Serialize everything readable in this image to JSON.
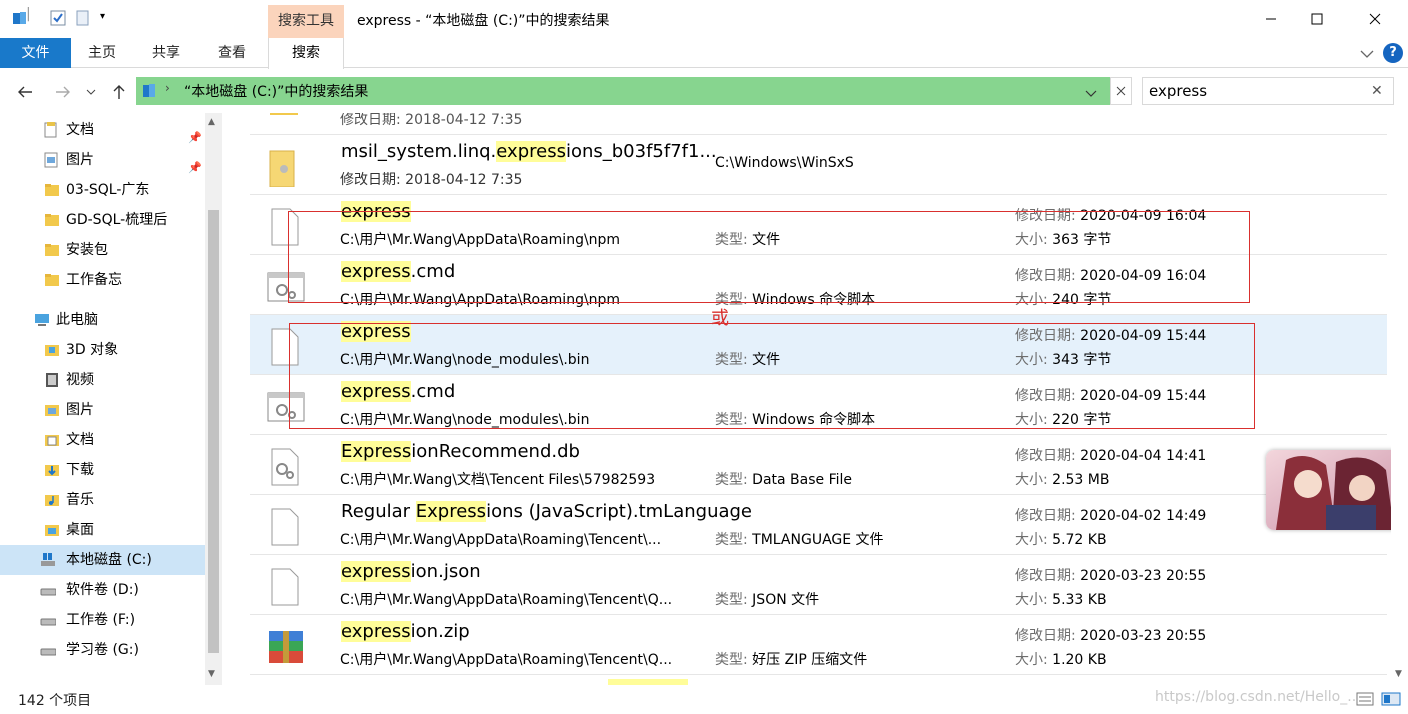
{
  "window": {
    "title": "express - “本地磁盘 (C:)”中的搜索结果",
    "context_tab": "搜索工具"
  },
  "ribbon": {
    "file": "文件",
    "tabs": [
      "主页",
      "共享",
      "查看"
    ],
    "search_tab": "搜索",
    "help": "?"
  },
  "address": {
    "path": "“本地磁盘 (C:)”中的搜索结果",
    "search_value": "express"
  },
  "nav": {
    "items": [
      {
        "label": "文档",
        "pinned": true
      },
      {
        "label": "图片",
        "pinned": true
      },
      {
        "label": "03-SQL-广东"
      },
      {
        "label": "GD-SQL-梳理后"
      },
      {
        "label": "安装包"
      },
      {
        "label": "工作备忘"
      },
      {
        "label": "此电脑"
      },
      {
        "label": "3D 对象"
      },
      {
        "label": "视频"
      },
      {
        "label": "图片"
      },
      {
        "label": "文档"
      },
      {
        "label": "下载"
      },
      {
        "label": "音乐"
      },
      {
        "label": "桌面"
      },
      {
        "label": "本地磁盘 (C:)",
        "selected": true
      },
      {
        "label": "软件卷 (D:)"
      },
      {
        "label": "工作卷 (F:)"
      },
      {
        "label": "学习卷 (G:)"
      }
    ]
  },
  "labels": {
    "modified": "修改日期:",
    "type": "类型:",
    "size": "大小:"
  },
  "results": [
    {
      "prefix": "",
      "match": "",
      "suffix": "",
      "partial_date": "修改日期: 2018-04-12 7:35"
    },
    {
      "prefix": "msil_system.linq.",
      "match": "express",
      "suffix": "ions_b03f5f7f1...",
      "path": "修改日期: 2018-04-12 7:35",
      "location": "C:\\Windows\\WinSxS"
    },
    {
      "prefix": "",
      "match": "express",
      "suffix": "",
      "path": "C:\\用户\\Mr.Wang\\AppData\\Roaming\\npm",
      "type": "文件",
      "date": "2020-04-09 16:04",
      "size": "363 字节"
    },
    {
      "prefix": "",
      "match": "express",
      "suffix": ".cmd",
      "path": "C:\\用户\\Mr.Wang\\AppData\\Roaming\\npm",
      "type": "Windows 命令脚本",
      "date": "2020-04-09 16:04",
      "size": "240 字节"
    },
    {
      "prefix": "",
      "match": "express",
      "suffix": "",
      "path": "C:\\用户\\Mr.Wang\\node_modules\\.bin",
      "type": "文件",
      "date": "2020-04-09 15:44",
      "size": "343 字节"
    },
    {
      "prefix": "",
      "match": "express",
      "suffix": ".cmd",
      "path": "C:\\用户\\Mr.Wang\\node_modules\\.bin",
      "type": "Windows 命令脚本",
      "date": "2020-04-09 15:44",
      "size": "220 字节"
    },
    {
      "prefix": "",
      "match": "Express",
      "suffix": "ionRecommend.db",
      "path": "C:\\用户\\Mr.Wang\\文档\\Tencent Files\\57982593",
      "type": "Data Base File",
      "date": "2020-04-04 14:41",
      "size": "2.53 MB"
    },
    {
      "prefix": "Regular ",
      "match": "Express",
      "suffix": "ions (JavaScript).tmLanguage",
      "path": "C:\\用户\\Mr.Wang\\AppData\\Roaming\\Tencent\\...",
      "type": "TMLANGUAGE 文件",
      "date": "2020-04-02 14:49",
      "size": "5.72 KB"
    },
    {
      "prefix": "",
      "match": "express",
      "suffix": "ion.json",
      "path": "C:\\用户\\Mr.Wang\\AppData\\Roaming\\Tencent\\Q...",
      "type": "JSON 文件",
      "date": "2020-03-23 20:55",
      "size": "5.33 KB"
    },
    {
      "prefix": "",
      "match": "express",
      "suffix": "ion.zip",
      "path": "C:\\用户\\Mr.Wang\\AppData\\Roaming\\Tencent\\Q...",
      "type": "好压 ZIP 压缩文件",
      "date": "2020-03-23 20:55",
      "size": "1.20 KB"
    }
  ],
  "annotation": {
    "or_text": "或"
  },
  "status": {
    "count": "142 个项目",
    "watermark": "https://blog.csdn.net/Hello_..."
  }
}
